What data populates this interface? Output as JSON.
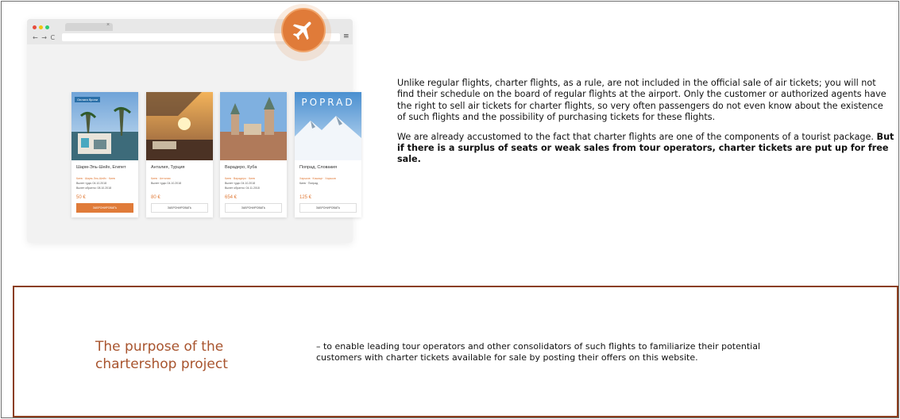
{
  "colors": {
    "accent": "#e07b39",
    "box_border": "#8b3e1e",
    "title": "#a8542e"
  },
  "browser": {
    "tab_close": "×",
    "nav_icons": "← → C",
    "menu_icon": "≡",
    "plane_icon": "airplane-icon"
  },
  "cards": [
    {
      "badge": "Оплата брони",
      "title": "Шарм-Эль-Шейх, Египет",
      "line1": "Киев · Шарм-Эль-Шейх · Киев",
      "line2": "Вылет туда: 04.10.2018",
      "line3": "Вылет обратно: 08.10.2018",
      "price": "50 €",
      "button": "ЗАБРОНИРОВАТЬ"
    },
    {
      "title": "Анталия, Турция",
      "line1": "Киев · Анталия",
      "line2": "Вылет туда: 04.10.2018",
      "price": "80 €",
      "button": "ЗАБРОНИРОВАТЬ"
    },
    {
      "title": "Варадеро, Куба",
      "line1": "Киев · Варадеро · Киев",
      "line2": "Вылет туда: 04.10.2018",
      "line3": "Вылет обратно: 04.11.2018",
      "price": "654 €",
      "button": "ЗАБРОНИРОВАТЬ"
    },
    {
      "image_text": "POPRAD",
      "title": "Попрад, Словакия",
      "line1": "Харьков · Кошице · Харьков",
      "line2": "Киев · Попрад",
      "price": "125 €",
      "button": "ЗАБРОНИРОВАТЬ"
    }
  ],
  "right": {
    "p1": "Unlike regular flights, charter flights, as a rule, are not included in the official sale of air tickets; you will not find their schedule on the board of regular flights at the airport. Only the customer or authorized agents have the right to sell air tickets for charter flights, so very often passengers do not even know about the existence of such flights and the possibility of purchasing tickets for these flights.",
    "p2": "We are already accustomed to the fact that charter flights are one of the components of a tourist package.",
    "p2_bold": "But if there is a surplus of seats or weak sales from tour operators, charter tickets are put up for free sale."
  },
  "purpose": {
    "title": "The purpose of the chartershop project",
    "text": "– to enable leading tour operators and other consolidators of such flights to familiarize their potential customers with charter tickets available for sale by posting their offers on this website."
  }
}
